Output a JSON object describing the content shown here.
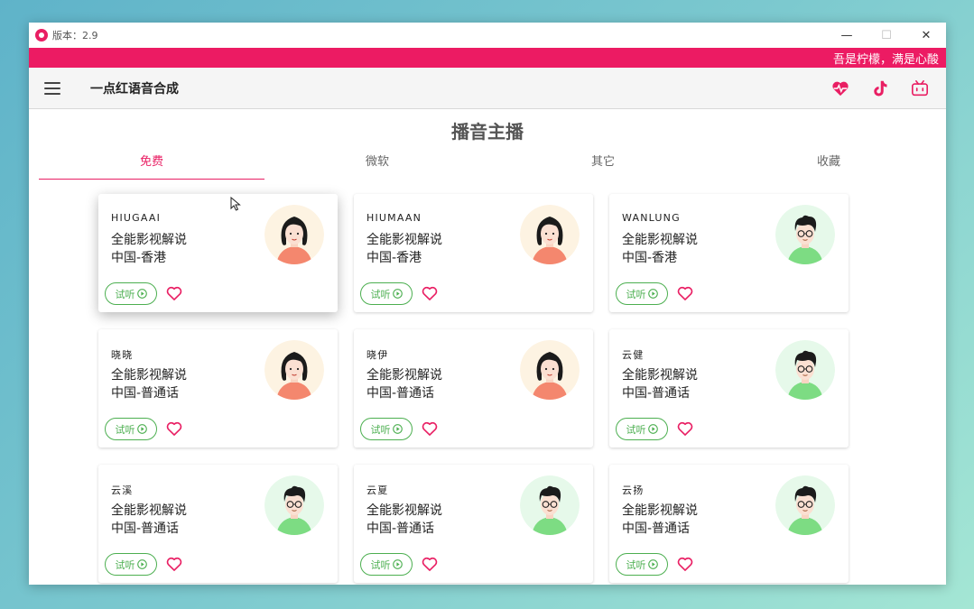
{
  "window": {
    "version_label": "版本：2.9",
    "controls": {
      "minimize": "—",
      "maximize": "☐",
      "close": "✕"
    }
  },
  "marquee": {
    "text": "吾是柠檬，满是心酸"
  },
  "appbar": {
    "title": "一点红语音合成",
    "actions": [
      "heartbeat-icon",
      "tiktok-icon",
      "bilibili-icon"
    ]
  },
  "page": {
    "title": "播音主播"
  },
  "tabs": [
    {
      "label": "免费",
      "active": true
    },
    {
      "label": "微软",
      "active": false
    },
    {
      "label": "其它",
      "active": false
    },
    {
      "label": "收藏",
      "active": false
    }
  ],
  "listen_label": "试听",
  "colors": {
    "accent": "#e91e63",
    "green": "#4caf50",
    "marquee": "#ec1b63"
  },
  "cards": [
    {
      "name": "HIUGAAI",
      "desc1": "全能影视解说",
      "desc2": "中国-香港",
      "avatar": "female"
    },
    {
      "name": "HIUMAAN",
      "desc1": "全能影视解说",
      "desc2": "中国-香港",
      "avatar": "female"
    },
    {
      "name": "WANLUNG",
      "desc1": "全能影视解说",
      "desc2": "中国-香港",
      "avatar": "male"
    },
    {
      "name": "晓晓",
      "desc1": "全能影视解说",
      "desc2": "中国-普通话",
      "avatar": "female"
    },
    {
      "name": "晓伊",
      "desc1": "全能影视解说",
      "desc2": "中国-普通话",
      "avatar": "female"
    },
    {
      "name": "云健",
      "desc1": "全能影视解说",
      "desc2": "中国-普通话",
      "avatar": "male"
    },
    {
      "name": "云溪",
      "desc1": "全能影视解说",
      "desc2": "中国-普通话",
      "avatar": "male"
    },
    {
      "name": "云夏",
      "desc1": "全能影视解说",
      "desc2": "中国-普通话",
      "avatar": "male"
    },
    {
      "name": "云扬",
      "desc1": "全能影视解说",
      "desc2": "中国-普通话",
      "avatar": "male"
    }
  ]
}
